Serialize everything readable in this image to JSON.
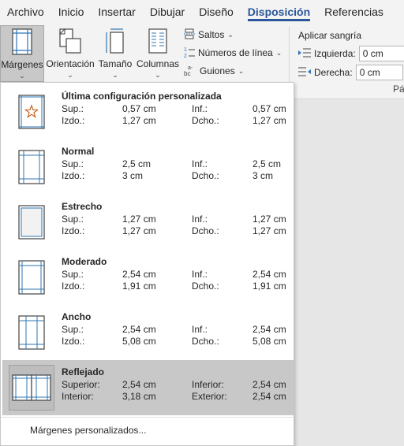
{
  "tabs": [
    "Archivo",
    "Inicio",
    "Insertar",
    "Dibujar",
    "Diseño",
    "Disposición",
    "Referencias"
  ],
  "active_tab": "Disposición",
  "ribbon": {
    "margins_label": "Márgenes",
    "orientation_label": "Orientación",
    "size_label": "Tamaño",
    "columns_label": "Columnas",
    "breaks_label": "Saltos",
    "line_numbers_label": "Números de línea",
    "hyphenation_label": "Guiones",
    "indent_title": "Aplicar sangría",
    "indent_left_label": "Izquierda:",
    "indent_left_value": "0 cm",
    "indent_right_label": "Derecha:",
    "indent_right_value": "0 cm",
    "group_label_fragment": "Pár"
  },
  "margin_presets": [
    {
      "name": "Última configuración personalizada",
      "k1": "Sup.:",
      "v1": "0,57 cm",
      "k2": "Inf.:",
      "v2": "0,57 cm",
      "k3": "Izdo.:",
      "v3": "1,27 cm",
      "k4": "Dcho.:",
      "v4": "1,27 cm",
      "icon": "star-page-icon"
    },
    {
      "name": "Normal",
      "k1": "Sup.:",
      "v1": "2,5 cm",
      "k2": "Inf.:",
      "v2": "2,5 cm",
      "k3": "Izdo.:",
      "v3": "3 cm",
      "k4": "Dcho.:",
      "v4": "3 cm",
      "icon": "page-margins-icon"
    },
    {
      "name": "Estrecho",
      "k1": "Sup.:",
      "v1": "1,27 cm",
      "k2": "Inf.:",
      "v2": "1,27 cm",
      "k3": "Izdo.:",
      "v3": "1,27 cm",
      "k4": "Dcho.:",
      "v4": "1,27 cm",
      "icon": "page-margins-icon"
    },
    {
      "name": "Moderado",
      "k1": "Sup.:",
      "v1": "2,54 cm",
      "k2": "Inf.:",
      "v2": "2,54 cm",
      "k3": "Izdo.:",
      "v3": "1,91 cm",
      "k4": "Dcho.:",
      "v4": "1,91 cm",
      "icon": "page-margins-icon"
    },
    {
      "name": "Ancho",
      "k1": "Sup.:",
      "v1": "2,54 cm",
      "k2": "Inf.:",
      "v2": "2,54 cm",
      "k3": "Izdo.:",
      "v3": "5,08 cm",
      "k4": "Dcho.:",
      "v4": "5,08 cm",
      "icon": "page-margins-icon"
    },
    {
      "name": "Reflejado",
      "k1": "Superior:",
      "v1": "2,54 cm",
      "k2": "Inferior:",
      "v2": "2,54 cm",
      "k3": "Interior:",
      "v3": "3,18 cm",
      "k4": "Exterior:",
      "v4": "2,54 cm",
      "icon": "mirrored-pages-icon"
    }
  ],
  "custom_margins_label": "Márgenes personalizados...",
  "colors": {
    "accent": "#2b579a",
    "guide": "#2e75b6",
    "star": "#c55a11",
    "selected_bg": "#c8c8c8"
  }
}
